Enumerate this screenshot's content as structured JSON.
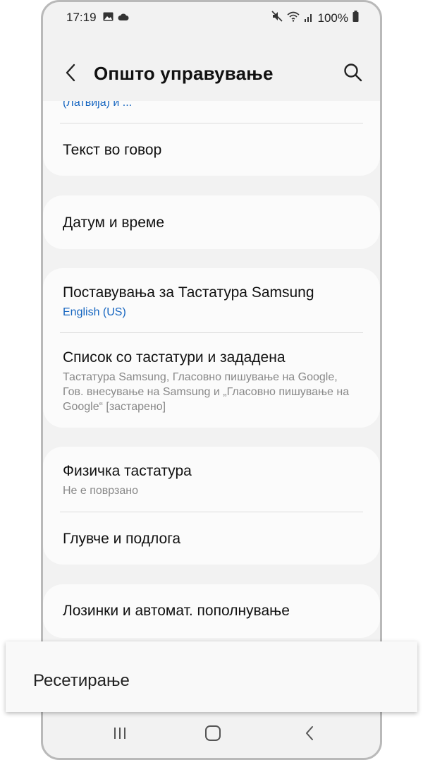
{
  "status_bar": {
    "time": "17:19",
    "battery": "100%",
    "icons": [
      "image-icon",
      "cloud-icon",
      "mute-icon",
      "wifi-icon",
      "signal-icon",
      "battery-icon"
    ]
  },
  "app_bar": {
    "title": "Општо управување"
  },
  "items": {
    "language_partial_sub": "(Латвија) и ...",
    "text_to_speech": "Текст во говор",
    "date_time": "Датум и време",
    "samsung_keyboard": {
      "title": "Поставувања за Тастатура Samsung",
      "sub": "English (US)"
    },
    "keyboard_list": {
      "title": "Список со тастатури и зададена",
      "sub": "Тастатура Samsung, Гласовно пишување на Google, Гов. внесување на Samsung и „Гласовно пишување на Google“ [застарено]"
    },
    "physical_keyboard": {
      "title": "Физичка тастатура",
      "sub": "Не е поврзано"
    },
    "mouse_trackpad": "Глувче и подлога",
    "passwords_autofill": "Лозинки и автомат. пополнување"
  },
  "highlight": {
    "reset": "Ресетирање"
  },
  "colors": {
    "accent": "#1565c0",
    "background": "#f2f2f2",
    "card": "#fbfbfb"
  }
}
